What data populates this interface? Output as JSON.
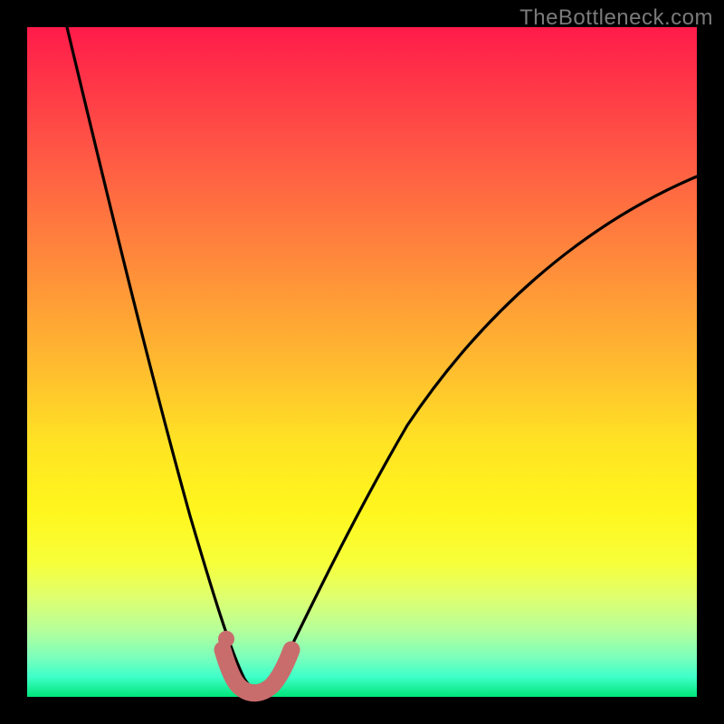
{
  "watermark": "TheBottleneck.com",
  "chart_data": {
    "type": "line",
    "title": "",
    "xlabel": "",
    "ylabel": "",
    "xlim": [
      0,
      100
    ],
    "ylim": [
      0,
      100
    ],
    "grid": false,
    "series": [
      {
        "name": "bottleneck-curve",
        "x": [
          6,
          10,
          15,
          20,
          24,
          27,
          30,
          32,
          34,
          36,
          38,
          42,
          47,
          55,
          65,
          78,
          92,
          100
        ],
        "y": [
          100,
          80,
          58,
          38,
          22,
          12,
          3,
          0,
          0,
          0,
          3,
          12,
          24,
          38,
          52,
          64,
          73,
          78
        ]
      }
    ],
    "highlight": {
      "name": "bottleneck-minimum-band",
      "color": "#c96c6c",
      "points_x": [
        29,
        30,
        31,
        32,
        33,
        34,
        35,
        36,
        37,
        38,
        39
      ],
      "points_y": [
        7,
        3,
        1,
        0,
        0,
        0,
        0,
        1,
        2,
        3,
        6
      ],
      "dot": {
        "x": 29.5,
        "y": 8
      }
    }
  },
  "colors": {
    "background": "#000000",
    "curve": "#000000",
    "highlight": "#c96c6c"
  }
}
